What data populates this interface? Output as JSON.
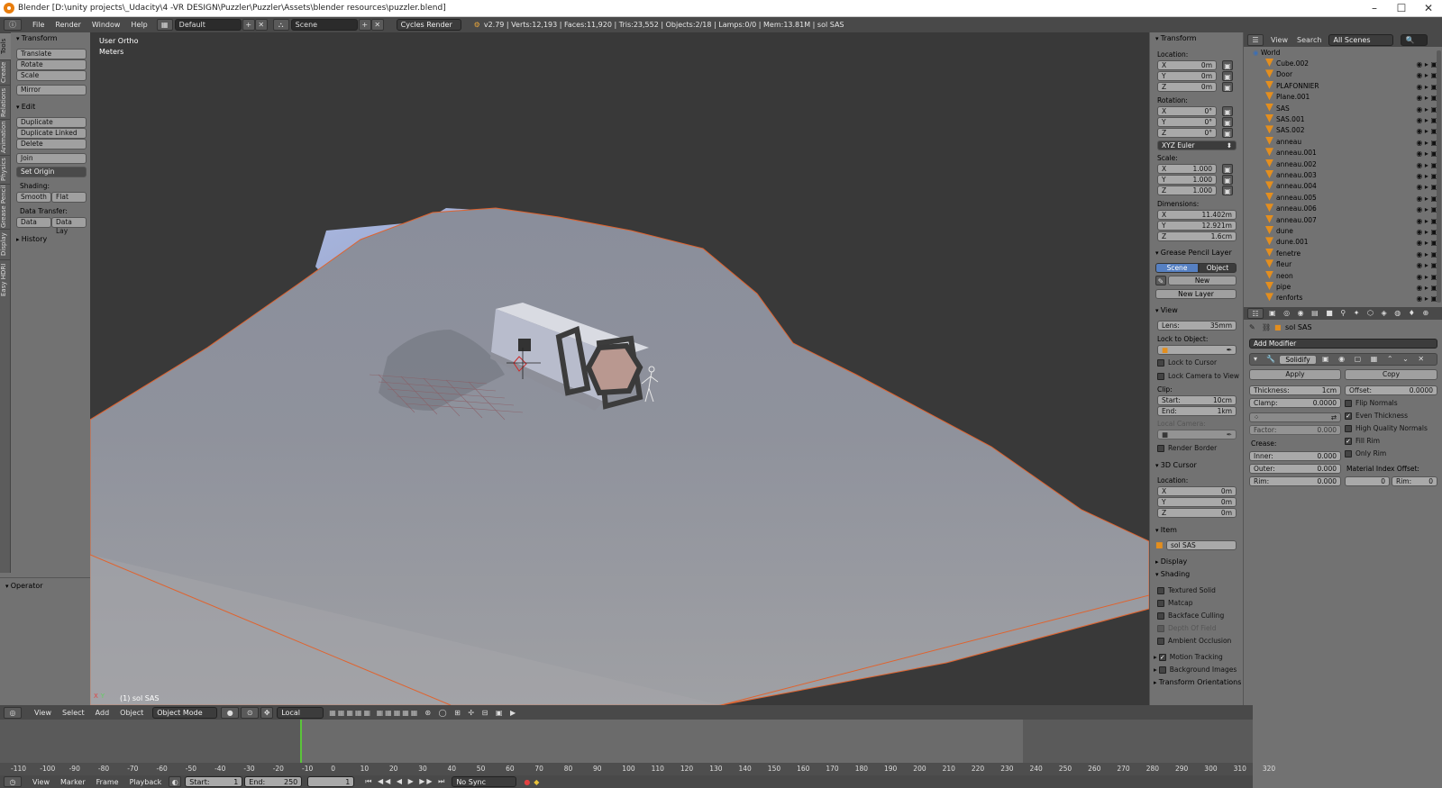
{
  "titlebar": {
    "title": "Blender [D:\\unity projects\\_Udacity\\4 -VR DESIGN\\Puzzler\\Puzzler\\Assets\\blender resources\\puzzler.blend]"
  },
  "menubar": {
    "menus": [
      "File",
      "Render",
      "Window",
      "Help"
    ],
    "layout": "Default",
    "scene": "Scene",
    "engine": "Cycles Render",
    "stats": "v2.79 | Verts:12,193 | Faces:11,920 | Tris:23,552 | Objects:2/18 | Lamps:0/0 | Mem:13.81M | sol SAS"
  },
  "vtabs": [
    "Tools",
    "Create",
    "Relations",
    "Animation",
    "Physics",
    "Grease Pencil",
    "Display",
    "Easy HDRI"
  ],
  "toolshelf": {
    "transform_title": "Transform",
    "translate": "Translate",
    "rotate": "Rotate",
    "scale": "Scale",
    "mirror": "Mirror",
    "edit_title": "Edit",
    "duplicate": "Duplicate",
    "duplicate_linked": "Duplicate Linked",
    "delete": "Delete",
    "join": "Join",
    "set_origin": "Set Origin",
    "shading_label": "Shading:",
    "smooth": "Smooth",
    "flat": "Flat",
    "data_transfer_label": "Data Transfer:",
    "data": "Data",
    "data_lay": "Data Lay",
    "history_title": "History",
    "operator_title": "Operator"
  },
  "viewport": {
    "view_name": "User Ortho",
    "units": "Meters",
    "object_label": "(1) sol SAS"
  },
  "npanel": {
    "transform_title": "Transform",
    "location_label": "Location:",
    "loc_x": "0m",
    "loc_y": "0m",
    "loc_z": "0m",
    "rotation_label": "Rotation:",
    "rot_x": "0°",
    "rot_y": "0°",
    "rot_z": "0°",
    "rotation_mode": "XYZ Euler",
    "scale_label": "Scale:",
    "scale_x": "1.000",
    "scale_y": "1.000",
    "scale_z": "1.000",
    "dimensions_label": "Dimensions:",
    "dim_x": "11.402m",
    "dim_y": "12.921m",
    "dim_z": "1.6cm",
    "grease_title": "Grease Pencil Layer",
    "scene_tab": "Scene",
    "object_tab": "Object",
    "new_btn": "New",
    "new_layer": "New Layer",
    "view_title": "View",
    "lens_label": "Lens:",
    "lens_value": "35mm",
    "lock_object_label": "Lock to Object:",
    "lock_cursor": "Lock to Cursor",
    "lock_camera": "Lock Camera to View",
    "clip_label": "Clip:",
    "clip_start_label": "Start:",
    "clip_start": "10cm",
    "clip_end_label": "End:",
    "clip_end": "1km",
    "local_camera": "Local Camera:",
    "render_border": "Render Border",
    "cursor_title": "3D Cursor",
    "cursor_location": "Location:",
    "cur_x": "0m",
    "cur_y": "0m",
    "cur_z": "0m",
    "item_title": "Item",
    "item_name": "sol SAS",
    "display_title": "Display",
    "shading_title": "Shading",
    "textured_solid": "Textured Solid",
    "matcap": "Matcap",
    "backface_culling": "Backface Culling",
    "depth_of_field": "Depth Of Field",
    "ambient_occlusion": "Ambient Occlusion",
    "motion_tracking": "Motion Tracking",
    "background_images": "Background Images",
    "transform_orientations": "Transform Orientations"
  },
  "axis_labels": {
    "x": "X",
    "y": "Y",
    "z": "Z"
  },
  "outliner": {
    "view": "View",
    "search": "Search",
    "scenes": "All Scenes",
    "world": "World",
    "items": [
      "Cube.002",
      "Door",
      "PLAFONNIER",
      "Plane.001",
      "SAS",
      "SAS.001",
      "SAS.002",
      "anneau",
      "anneau.001",
      "anneau.002",
      "anneau.003",
      "anneau.004",
      "anneau.005",
      "anneau.006",
      "anneau.007",
      "dune",
      "dune.001",
      "fenetre",
      "fleur",
      "neon",
      "pipe",
      "renforts"
    ]
  },
  "properties": {
    "object_name": "sol SAS",
    "add_modifier": "Add Modifier",
    "modifier_name": "Solidify",
    "apply": "Apply",
    "copy": "Copy",
    "thickness_label": "Thickness:",
    "thickness": "1cm",
    "offset_label": "Offset:",
    "offset": "0.0000",
    "clamp_label": "Clamp:",
    "clamp": "0.0000",
    "flip_normals": "Flip Normals",
    "even_thickness": "Even Thickness",
    "high_quality_normals": "High Quality Normals",
    "fill_rim": "Fill Rim",
    "only_rim": "Only Rim",
    "factor_label": "Factor:",
    "factor": "0.000",
    "crease_label": "Crease:",
    "inner_label": "Inner:",
    "inner": "0.000",
    "outer_label": "Outer:",
    "outer": "0.000",
    "rim_label": "Rim:",
    "rim": "0.000",
    "material_index_label": "Material Index Offset:",
    "mat_index": "0",
    "mat_rim_label": "Rim:",
    "mat_rim": "0"
  },
  "view3d_header": {
    "menus": [
      "View",
      "Select",
      "Add",
      "Object"
    ],
    "mode": "Object Mode",
    "orientation": "Local"
  },
  "timeline": {
    "ticks": [
      "-110",
      "-100",
      "-90",
      "-80",
      "-70",
      "-60",
      "-50",
      "-40",
      "-30",
      "-20",
      "-10",
      "0",
      "10",
      "20",
      "30",
      "40",
      "50",
      "60",
      "70",
      "80",
      "90",
      "100",
      "110",
      "120",
      "130",
      "140",
      "150",
      "160",
      "170",
      "180",
      "190",
      "200",
      "210",
      "220",
      "230",
      "240",
      "250",
      "260",
      "270",
      "280",
      "290",
      "300",
      "310",
      "320"
    ],
    "menus": [
      "View",
      "Marker",
      "Frame",
      "Playback"
    ],
    "start_label": "Start:",
    "start": "1",
    "end_label": "End:",
    "end": "250",
    "current": "1",
    "sync": "No Sync"
  }
}
